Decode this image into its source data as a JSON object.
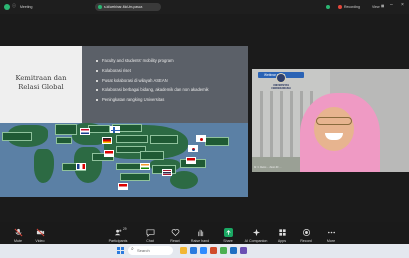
{
  "topbar": {
    "app_label": "Meeting",
    "url": "s.id/webinar-MoUm-pasca",
    "recording": "Recording",
    "view": "View"
  },
  "slide": {
    "title": "Kemitraan dan Relasi Global",
    "bullets": [
      "Faculty and students' mobility program",
      "Kolaborasi riset",
      "Pusat kolaborasi di wilayah ASEAN",
      "Kolaborasi berbagai bidang, akademik dan non akademik",
      "Peningkatan rangking Universitas"
    ]
  },
  "video": {
    "tag": "Webinar pasca",
    "logo_text": "UNIVERSITAS CENDERAWASIH",
    "name": "Dr. Ir. Retno ... Zoom ID: ..."
  },
  "toolbar": {
    "mute": "Mute",
    "video": "Video",
    "participants": "Participants",
    "participants_count": "29",
    "chat": "Chat",
    "react": "React",
    "share": "Share",
    "select_hand": "Raise hand",
    "ai_companion": "AI Companion",
    "apps": "Apps",
    "record": "Record",
    "more": "More",
    "search": "Search"
  },
  "colors": {
    "share_green": "#1aa863",
    "zoom_blue": "#2a63b5",
    "recording_red": "#e5473b"
  }
}
